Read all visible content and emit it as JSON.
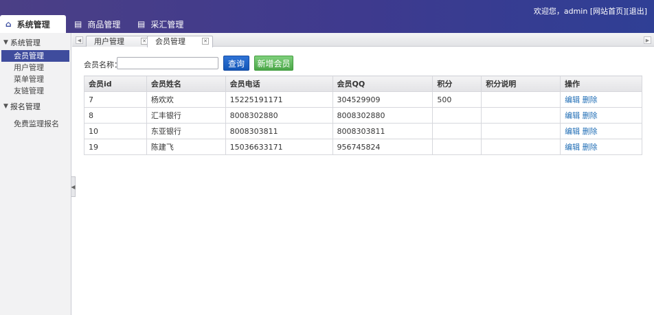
{
  "header": {
    "welcome": "欢迎您，admin",
    "home_link": "[网站首页]",
    "logout_link": "[退出]",
    "nav": [
      {
        "label": "系统管理"
      },
      {
        "label": "商品管理"
      },
      {
        "label": "采汇管理"
      }
    ]
  },
  "sidebar": {
    "groups": [
      {
        "label": "系统管理",
        "items": [
          {
            "label": "会员管理"
          },
          {
            "label": "用户管理"
          },
          {
            "label": "菜单管理"
          },
          {
            "label": "友链管理"
          }
        ]
      },
      {
        "label": "报名管理",
        "items": [
          {
            "label": "免费监理报名"
          }
        ]
      }
    ]
  },
  "tabs": [
    {
      "label": "用户管理"
    },
    {
      "label": "会员管理"
    }
  ],
  "search": {
    "label": "会员名称：",
    "value": "",
    "query_label": "查询",
    "add_label": "新增会员"
  },
  "table": {
    "columns": [
      "会员id",
      "会员姓名",
      "会员电话",
      "会员QQ",
      "积分",
      "积分说明",
      "操作"
    ],
    "edit_label": "编辑",
    "delete_label": "删除",
    "rows": [
      {
        "id": "7",
        "name": "杨欢欢",
        "phone": "15225191171",
        "qq": "304529909",
        "points": "500",
        "note": ""
      },
      {
        "id": "8",
        "name": "汇丰银行",
        "phone": "8008302880",
        "qq": "8008302880",
        "points": "",
        "note": ""
      },
      {
        "id": "10",
        "name": "东亚银行",
        "phone": "8008303811",
        "qq": "8008303811",
        "points": "",
        "note": ""
      },
      {
        "id": "19",
        "name": "陈建飞",
        "phone": "15036633171",
        "qq": "956745824",
        "points": "",
        "note": ""
      }
    ]
  }
}
